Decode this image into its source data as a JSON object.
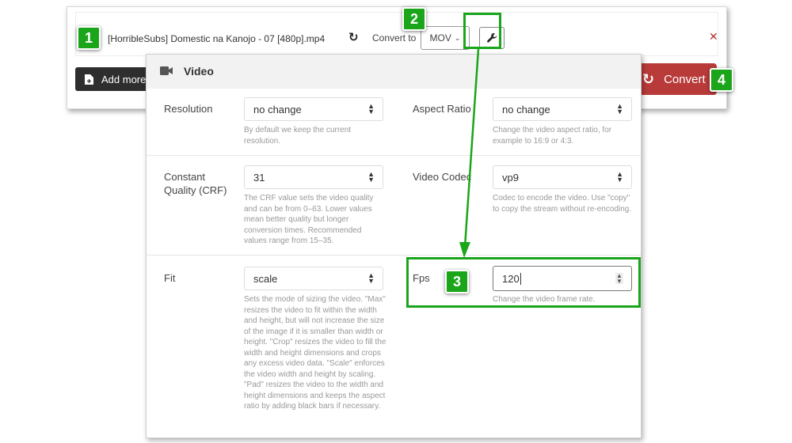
{
  "file": {
    "name": "[HorribleSubs] Domestic na Kanojo - 07 [480p].mp4",
    "convert_to_label": "Convert to",
    "format": "MOV",
    "remove_icon": "close-icon",
    "settings_icon": "wrench-icon"
  },
  "actions": {
    "add_more_label": "Add more",
    "convert_label": "Convert"
  },
  "colors": {
    "convert": "#b83b3a",
    "annotation": "#1aa51a",
    "add_more": "#2e2e2e"
  },
  "panel": {
    "title": "Video",
    "fields": [
      {
        "label": "Resolution",
        "value": "no change",
        "help": "By default we keep the current resolution."
      },
      {
        "label": "Aspect Ratio",
        "value": "no change",
        "help": "Change the video aspect ratio, for example to 16:9 or 4:3."
      },
      {
        "label": "Constant Quality (CRF)",
        "value": "31",
        "help": "The CRF value sets the video quality and can be from 0–63. Lower values mean better quality but longer conversion times. Recommended values range from 15–35."
      },
      {
        "label": "Video Codec",
        "value": "vp9",
        "help": "Codec to encode the video. Use \"copy\" to copy the stream without re-encoding."
      },
      {
        "label": "Fit",
        "value": "scale",
        "help": "Sets the mode of sizing the video. \"Max\" resizes the video to fit within the width and height, but will not increase the size of the image if it is smaller than width or height. \"Crop\" resizes the video to fill the width and height dimensions and crops any excess video data. \"Scale\" enforces the video width and height by scaling. \"Pad\" resizes the video to the width and height dimensions and keeps the aspect ratio by adding black bars if necessary."
      },
      {
        "label": "Fps",
        "value": "120",
        "help": "Change the video frame rate."
      }
    ]
  },
  "annotations": [
    "1",
    "2",
    "3",
    "4"
  ]
}
